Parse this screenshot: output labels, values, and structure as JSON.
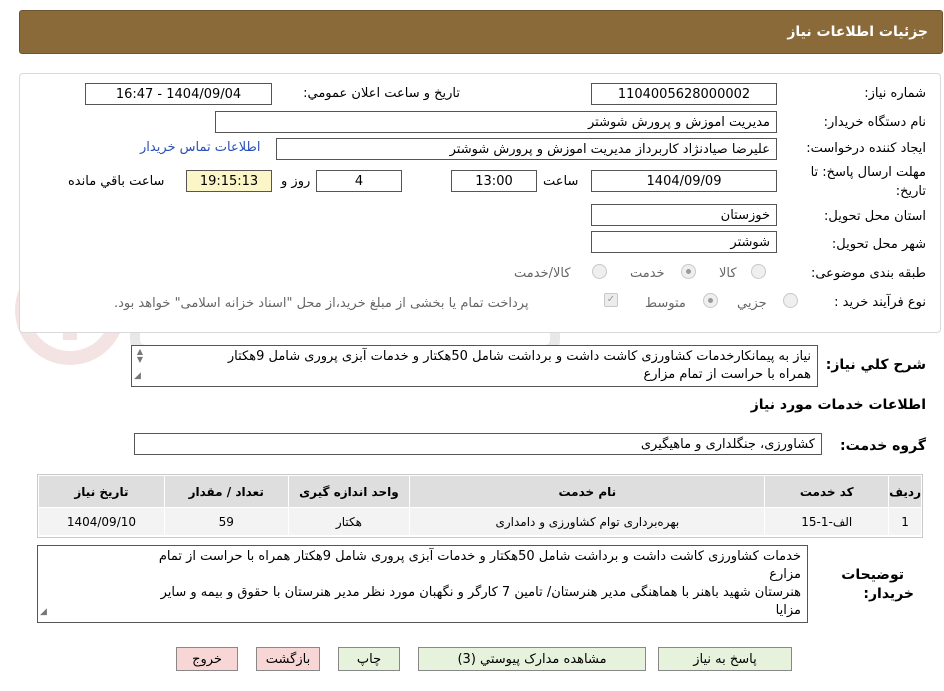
{
  "header": {
    "title": "جزئیات اطلاعات نیاز"
  },
  "form": {
    "need_number_label": "شماره نیاز:",
    "need_number": "1104005628000002",
    "announce_label": "تاریخ و ساعت اعلان عمومي:",
    "announce_value": "1404/09/04 - 16:47",
    "buyer_org_label": "نام دستگاه خریدار:",
    "buyer_org": "مدیریت اموزش و پرورش شوشتر",
    "requester_label": "ایجاد کننده درخواست:",
    "requester": "علیرضا صیادنژاد کاربرداز مدیریت اموزش و پرورش شوشتر",
    "contact_link": "اطلاعات تماس خریدار",
    "deadline_label_1": "مهلت ارسال پاسخ: تا",
    "deadline_label_2": "تاریخ:",
    "deadline_date": "1404/09/09",
    "time_label": "ساعت",
    "deadline_time": "13:00",
    "days": "4",
    "days_label": "روز و",
    "remaining_time": "19:15:13",
    "remaining_label": "ساعت باقي مانده",
    "province_label": "استان محل تحویل:",
    "province": "خوزستان",
    "city_label": "شهر محل تحویل:",
    "city": "شوشتر",
    "category_label": "طبقه بندی موضوعی:",
    "category_options": [
      "کالا",
      "خدمت",
      "کالا/خدمت"
    ],
    "process_label": "نوع فرآیند خرید :",
    "process_options": [
      "جزيي",
      "متوسط"
    ],
    "payment_note": "پرداخت تمام یا بخشی از مبلغ خرید،از محل \"اسناد خزانه اسلامی\" خواهد بود."
  },
  "description": {
    "label": "شرح کلي نیاز:",
    "text_line1": "نیاز به پیمانکارخدمات کشاورزی کاشت داشت و برداشت شامل 50هکتار و خدمات آبزی پروری شامل 9هکتار",
    "text_line2": "همراه با حراست از تمام مزارع"
  },
  "services": {
    "title": "اطلاعات خدمات مورد نیاز",
    "group_label": "گروه خدمت:",
    "group_value": "کشاورزی، جنگلداری و ماهیگیری",
    "columns": [
      "ردیف",
      "کد خدمت",
      "نام خدمت",
      "واحد اندازه گیری",
      "تعداد / مقدار",
      "تاریخ نیاز"
    ],
    "rows": [
      {
        "row": "1",
        "code": "الف-1-15",
        "name": "بهره‌برداری توام کشاورزی و دامداری",
        "unit": "هکتار",
        "qty": "59",
        "date": "1404/09/10"
      }
    ]
  },
  "buyer_notes": {
    "label_1": "توضیحات",
    "label_2": "خریدار:",
    "line1": "خدمات کشاورزی کاشت داشت و برداشت شامل 50هکتار و خدمات آبزی پروری شامل 9هکتار همراه با حراست از تمام",
    "line2": "مزارع",
    "line3": "هنرستان شهید باهنر با هماهنگی مدیر هنرستان/ تامین 7 کارگر و نگهبان مورد نظر مدیر هنرستان با حقوق و بیمه و سایر",
    "line4": "مزایا"
  },
  "buttons": {
    "reply": "پاسخ به نیاز",
    "attachments": "مشاهده مدارک پیوستي (3)",
    "print": "چاپ",
    "back": "بازگشت",
    "exit": "خروج"
  },
  "colors": {
    "header_bg": "#8b6a3a",
    "button_green": "#e6f2dc",
    "button_pink": "#f8d6d6",
    "highlight_yellow": "#fbf5c8",
    "link": "#2a4fb8"
  }
}
